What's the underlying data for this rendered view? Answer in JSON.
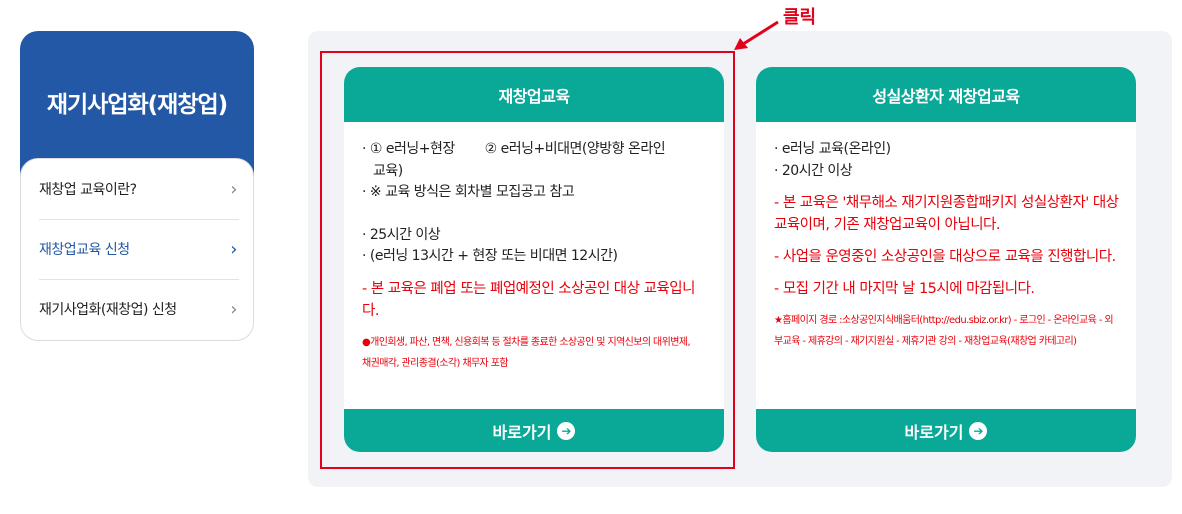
{
  "sidebar": {
    "title": "재기사업화(재창업)",
    "items": [
      {
        "label": "재창업 교육이란?"
      },
      {
        "label": "재창업교육 신청"
      },
      {
        "label": "재기사업화(재창업) 신청"
      }
    ],
    "chevron": "›"
  },
  "annotation": {
    "click_label": "클릭"
  },
  "cards": [
    {
      "title": "재창업교육",
      "lines": [
        "· ① e러닝+현장",
        "② e러닝+비대면(양방향 온라인",
        "교육)",
        "· ※ 교육 방식은 회차별 모집공고 참고",
        "· 25시간 이상",
        "· (e러닝 13시간 + 현장 또는 비대면 12시간)"
      ],
      "red_text": "- 본 교육은 폐업 또는 폐업예정인 소상공인 대상 교육입니다.",
      "notes": [
        "●개인회생, 파산, 면책, 신용회복 등 절차를 종료한 소상공인 및 지역신보의 대위변제,",
        "채권매각, 관리종결(소각) 채무자 포함"
      ],
      "button_label": "바로가기"
    },
    {
      "title": "성실상환자 재창업교육",
      "lines": [
        "· e러닝 교육(온라인)",
        "· 20시간 이상"
      ],
      "red_paragraphs": [
        "- 본 교육은 '채무해소 재기지원종합패키지 성실상환자' 대상 교육이며, 기존 재창업교육이 아닙니다.",
        "- 사업을 운영중인 소상공인을 대상으로 교육을 진행합니다.",
        "- 모집 기간 내 마지막 날 15시에 마감됩니다."
      ],
      "note": "★홈페이지 경로 :소상공인지식배움터(http://edu.sbiz.or.kr) - 로그인 - 온라인교육 - 외부교육 - 제휴강의 - 재기지원실 - 제휴기관 강의 - 재창업교육(재창업 카테고리)",
      "button_label": "바로가기"
    }
  ],
  "icons": {
    "button_arrow": "arrow-right-circle-icon",
    "menu_chevron": "chevron-right-icon"
  },
  "colors": {
    "brand_blue": "#2358a6",
    "teal": "#0aa997",
    "alert_red": "#e8000a",
    "highlight_red": "#e3001b",
    "panel_bg": "#f2f3f6"
  }
}
